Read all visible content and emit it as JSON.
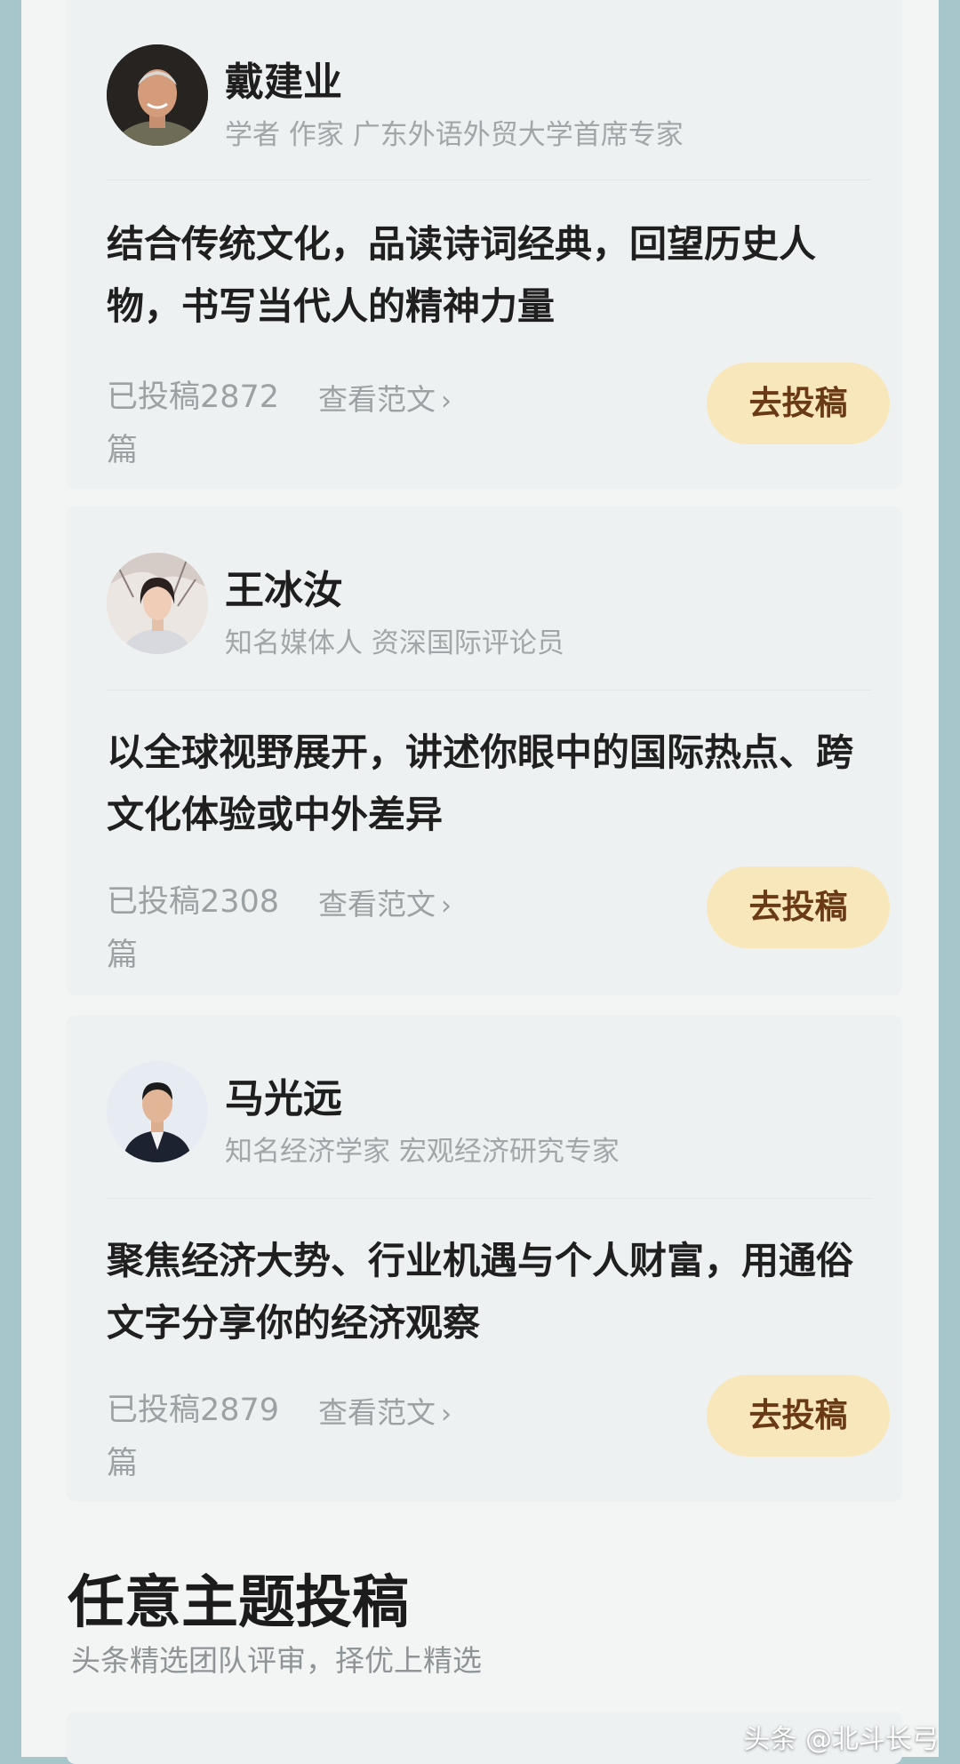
{
  "cards": [
    {
      "name": "戴建业",
      "title": "学者 作家 广东外语外贸大学首席专家",
      "description": "结合传统文化，品读诗词经典，回望历史人物，书写当代人的精神力量",
      "count": "已投稿2872篇",
      "sample_link": "查看范文",
      "submit_label": "去投稿"
    },
    {
      "name": "王冰汝",
      "title": "知名媒体人 资深国际评论员",
      "description": "以全球视野展开，讲述你眼中的国际热点、跨文化体验或中外差异",
      "count": "已投稿2308篇",
      "sample_link": "查看范文",
      "submit_label": "去投稿"
    },
    {
      "name": "马光远",
      "title": "知名经济学家 宏观经济研究专家",
      "description": "聚焦经济大势、行业机遇与个人财富，用通俗文字分享你的经济观察",
      "count": "已投稿2879篇",
      "sample_link": "查看范文",
      "submit_label": "去投稿"
    }
  ],
  "section": {
    "title": "任意主题投稿",
    "subtitle": "头条精选团队评审，择优上精选"
  },
  "watermark": "头条 @北斗长弓",
  "colors": {
    "background": "#a7c6cb",
    "panel": "#f3f5f5",
    "card": "#edf1f2",
    "submit_button": "#f9e7bc",
    "submit_text": "#6a3a16",
    "muted_text": "#9ca1a3"
  }
}
